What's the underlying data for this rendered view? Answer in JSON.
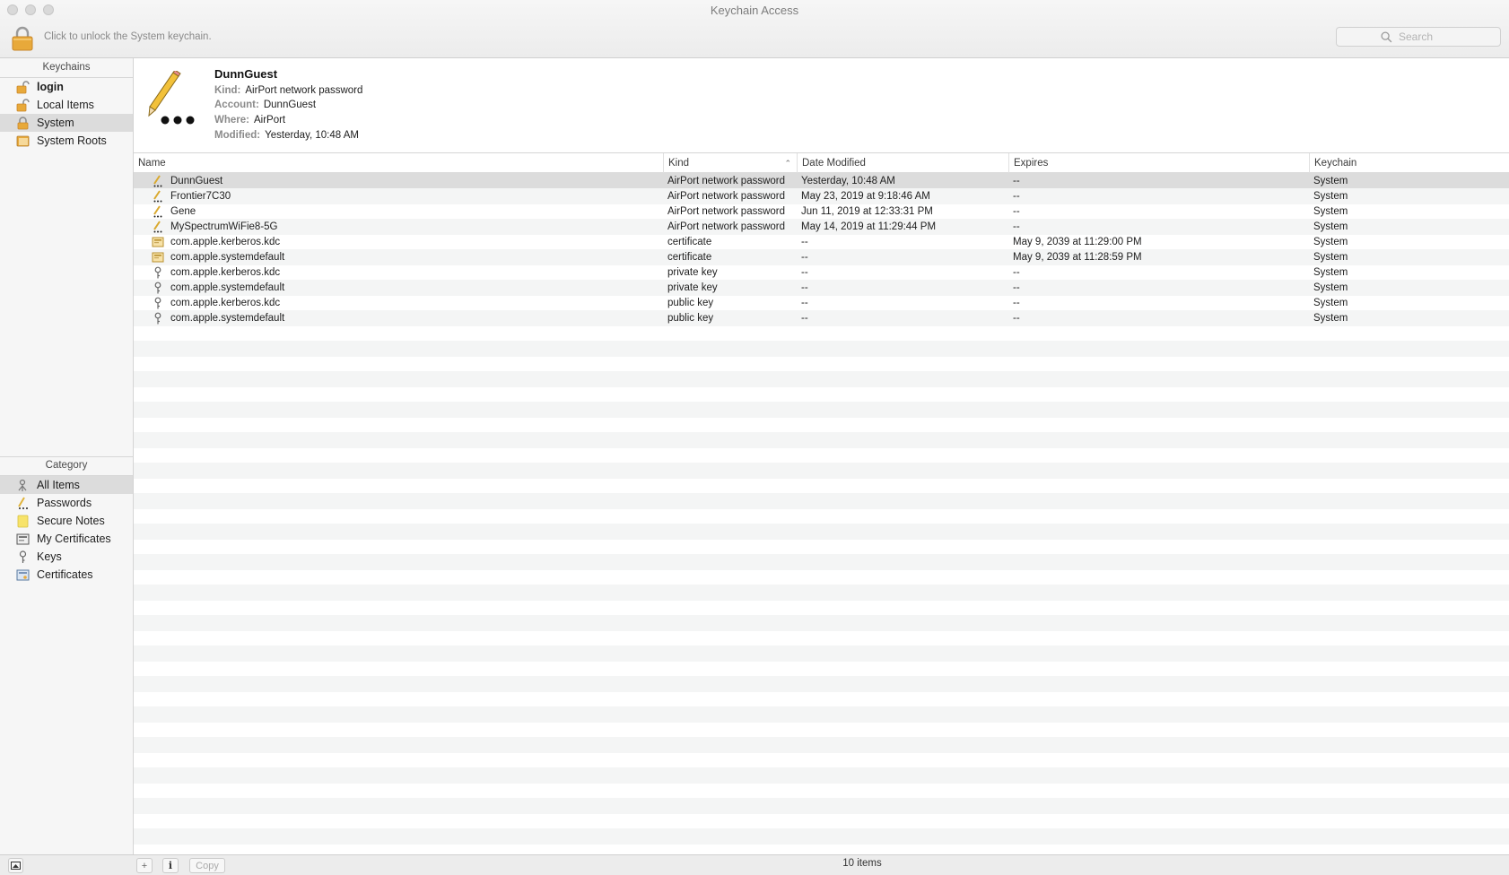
{
  "window": {
    "title": "Keychain Access",
    "lock_hint": "Click to unlock the System keychain.",
    "search_placeholder": "Search"
  },
  "sidebar": {
    "keychains_header": "Keychains",
    "keychains": [
      {
        "label": "login",
        "icon": "unlocked-lock-icon",
        "bold": true
      },
      {
        "label": "Local Items",
        "icon": "unlocked-lock-icon",
        "bold": false
      },
      {
        "label": "System",
        "icon": "locked-lock-icon",
        "bold": false,
        "selected": true
      },
      {
        "label": "System Roots",
        "icon": "folder-icon",
        "bold": false
      }
    ],
    "category_header": "Category",
    "categories": [
      {
        "label": "All Items",
        "icon": "all-items-icon",
        "selected": true
      },
      {
        "label": "Passwords",
        "icon": "password-icon"
      },
      {
        "label": "Secure Notes",
        "icon": "secure-note-icon"
      },
      {
        "label": "My Certificates",
        "icon": "my-certificate-icon"
      },
      {
        "label": "Keys",
        "icon": "key-icon"
      },
      {
        "label": "Certificates",
        "icon": "certificate-icon"
      }
    ]
  },
  "detail": {
    "title": "DunnGuest",
    "kind_label": "Kind:",
    "kind": "AirPort network password",
    "account_label": "Account:",
    "account": "DunnGuest",
    "where_label": "Where:",
    "where": "AirPort",
    "modified_label": "Modified:",
    "modified": "Yesterday, 10:48 AM"
  },
  "table": {
    "columns": [
      "Name",
      "Kind",
      "Date Modified",
      "Expires",
      "Keychain"
    ],
    "rows": [
      {
        "name": "DunnGuest",
        "kind": "AirPort network password",
        "modified": "Yesterday, 10:48 AM",
        "expires": "--",
        "keychain": "System",
        "icon": "password-icon",
        "selected": true
      },
      {
        "name": "Frontier7C30",
        "kind": "AirPort network password",
        "modified": "May 23, 2019 at 9:18:46 AM",
        "expires": "--",
        "keychain": "System",
        "icon": "password-icon"
      },
      {
        "name": "Gene",
        "kind": "AirPort network password",
        "modified": "Jun 11, 2019 at 12:33:31 PM",
        "expires": "--",
        "keychain": "System",
        "icon": "password-icon"
      },
      {
        "name": "MySpectrumWiFie8-5G",
        "kind": "AirPort network password",
        "modified": "May 14, 2019 at 11:29:44 PM",
        "expires": "--",
        "keychain": "System",
        "icon": "password-icon"
      },
      {
        "name": "com.apple.kerberos.kdc",
        "kind": "certificate",
        "modified": "--",
        "expires": "May 9, 2039 at 11:29:00 PM",
        "keychain": "System",
        "icon": "certificate-icon"
      },
      {
        "name": "com.apple.systemdefault",
        "kind": "certificate",
        "modified": "--",
        "expires": "May 9, 2039 at 11:28:59 PM",
        "keychain": "System",
        "icon": "certificate-icon"
      },
      {
        "name": "com.apple.kerberos.kdc",
        "kind": "private key",
        "modified": "--",
        "expires": "--",
        "keychain": "System",
        "icon": "key-icon"
      },
      {
        "name": "com.apple.systemdefault",
        "kind": "private key",
        "modified": "--",
        "expires": "--",
        "keychain": "System",
        "icon": "key-icon"
      },
      {
        "name": "com.apple.kerberos.kdc",
        "kind": "public key",
        "modified": "--",
        "expires": "--",
        "keychain": "System",
        "icon": "key-icon"
      },
      {
        "name": "com.apple.systemdefault",
        "kind": "public key",
        "modified": "--",
        "expires": "--",
        "keychain": "System",
        "icon": "key-icon"
      }
    ]
  },
  "footer": {
    "add_label": "+",
    "info_label": "i",
    "copy_label": "Copy",
    "status": "10 items"
  },
  "colors": {
    "lock": "#e8a93a",
    "selection": "#dcdcdc",
    "stripe": "#f4f5f5"
  }
}
